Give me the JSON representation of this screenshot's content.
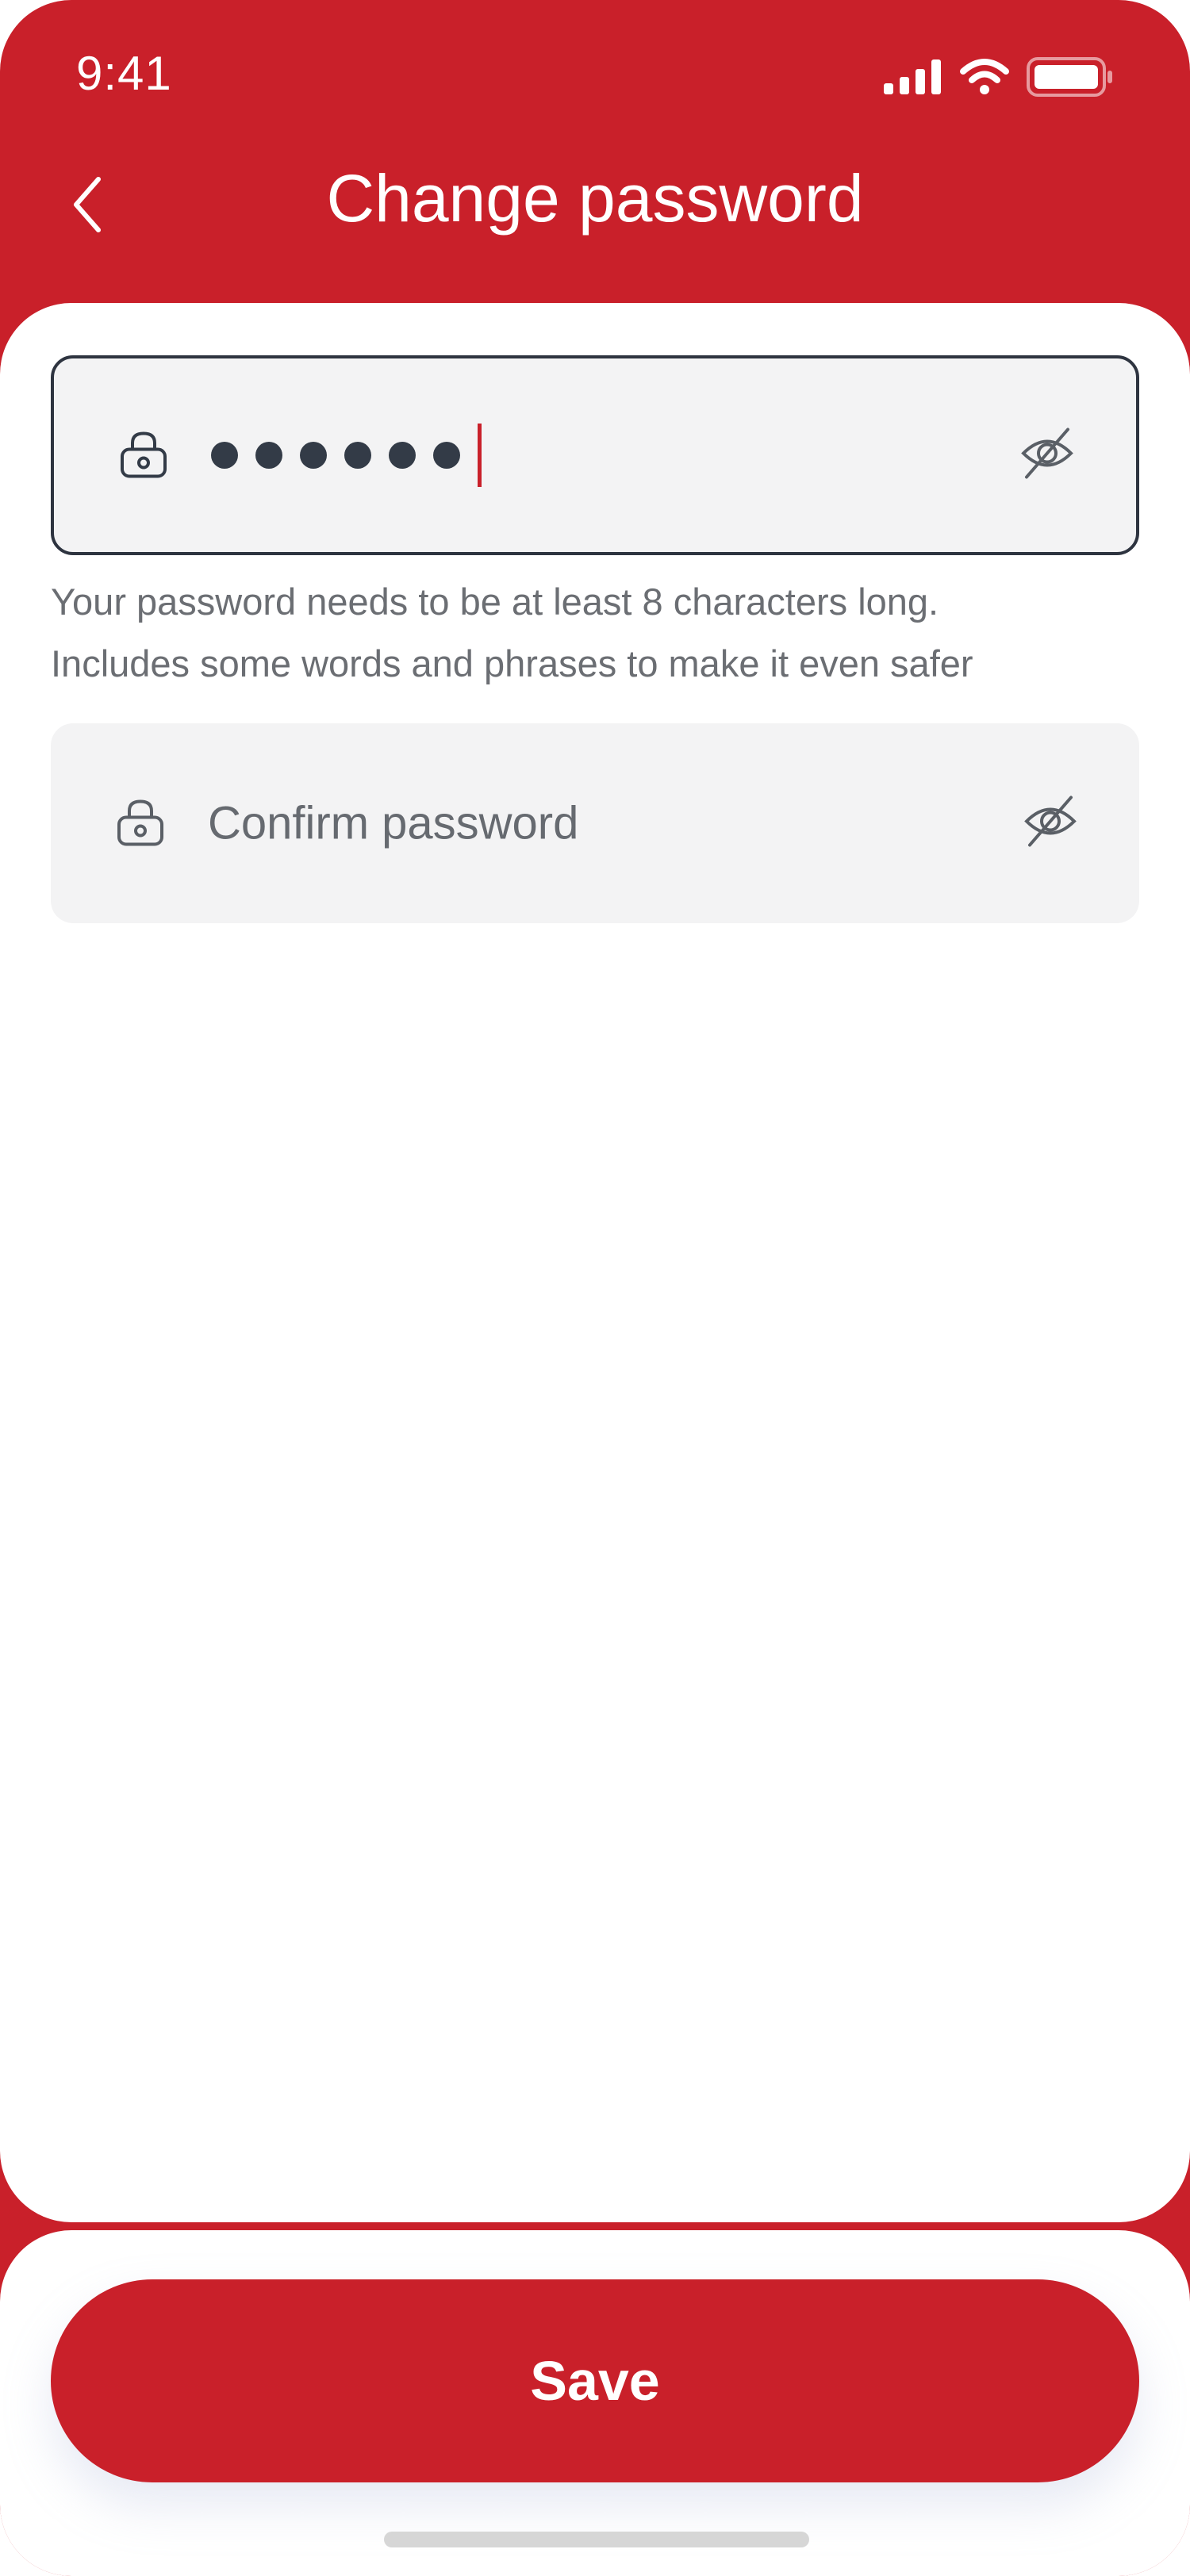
{
  "status_bar": {
    "time": "9:41",
    "icons": [
      "signal-icon",
      "wifi-icon",
      "battery-icon"
    ]
  },
  "header": {
    "title": "Change password",
    "back_icon": "chevron-left-icon"
  },
  "password_field": {
    "masked_length": 6,
    "icon": "lock-icon",
    "toggle_icon": "eye-off-icon"
  },
  "hint": {
    "line1": "Your password needs to be at least 8 characters long.",
    "line2": "Includes some words and phrases to make it even safer"
  },
  "confirm_field": {
    "placeholder": "Confirm password",
    "value": "",
    "icon": "lock-icon",
    "toggle_icon": "eye-off-icon"
  },
  "footer": {
    "save_label": "Save"
  },
  "colors": {
    "brand": "#C9202A",
    "field_bg": "#F3F3F4",
    "text_dark": "#333B47",
    "text_muted": "#6B6E73"
  }
}
